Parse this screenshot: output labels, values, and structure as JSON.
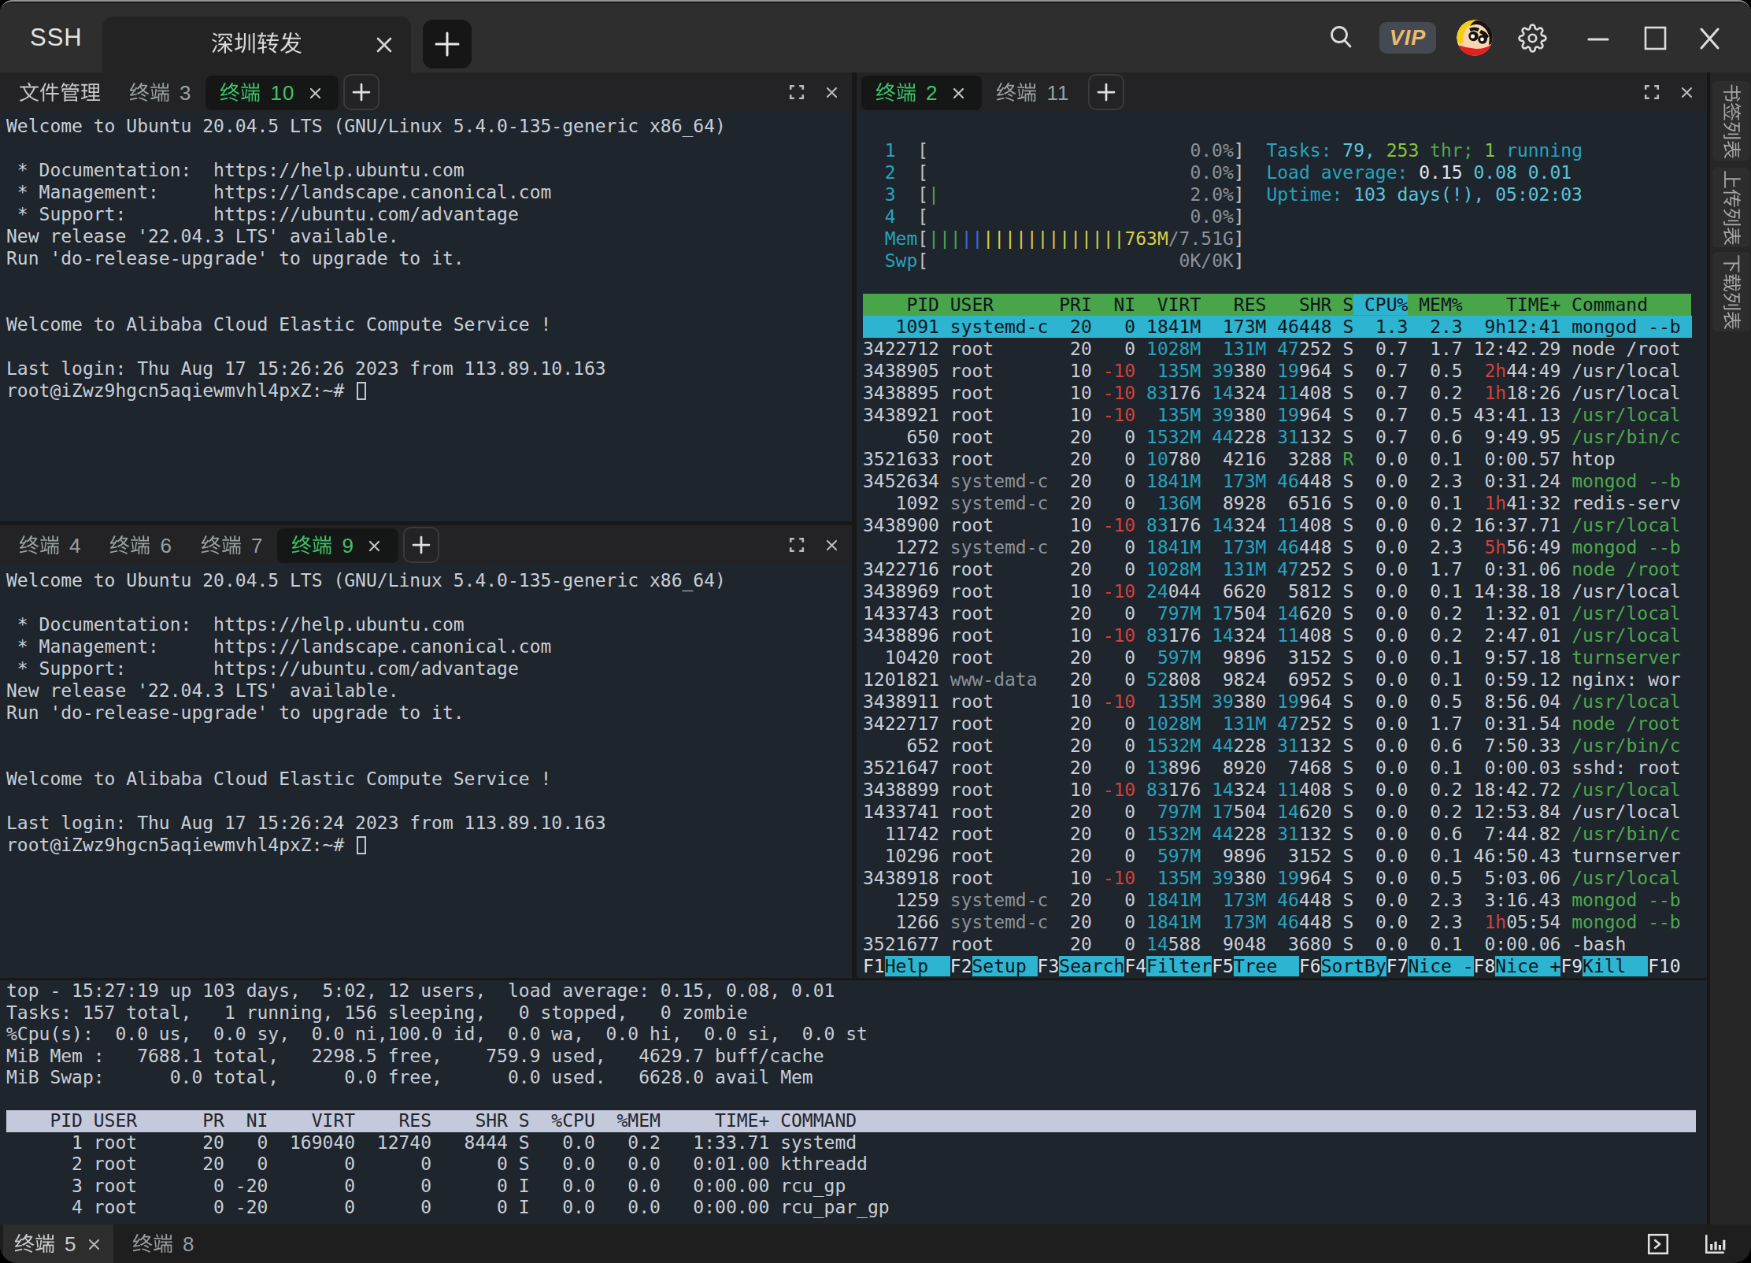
{
  "titlebar": {
    "app_label": "SSH",
    "window_tab": {
      "title": "深圳转发"
    },
    "new_tab_icon": "+",
    "vip_label": "VIP",
    "icons": [
      "search-icon",
      "vip-badge",
      "avatar",
      "gear-icon",
      "minimize-icon",
      "maximize-icon",
      "close-icon"
    ]
  },
  "panes": {
    "top_left": {
      "tabs": [
        {
          "label": "文件管理",
          "state": "first"
        },
        {
          "label": "终端",
          "num": "3",
          "state": "dim"
        },
        {
          "label": "终端",
          "num": "10",
          "state": "active",
          "closable": true
        }
      ],
      "terminal": {
        "lines": [
          "Welcome to Ubuntu 20.04.5 LTS (GNU/Linux 5.4.0-135-generic x86_64)",
          "",
          " * Documentation:  https://help.ubuntu.com",
          " * Management:     https://landscape.canonical.com",
          " * Support:        https://ubuntu.com/advantage",
          "New release '22.04.3 LTS' available.",
          "Run 'do-release-upgrade' to upgrade to it.",
          "",
          "",
          "Welcome to Alibaba Cloud Elastic Compute Service !",
          "",
          "Last login: Thu Aug 17 15:26:26 2023 from 113.89.10.163"
        ],
        "prompt": "root@iZwz9hgcn5aqiewmvhl4pxZ:~# "
      }
    },
    "bottom_left": {
      "tabs": [
        {
          "label": "终端",
          "num": "4",
          "state": "dim"
        },
        {
          "label": "终端",
          "num": "6",
          "state": "dim"
        },
        {
          "label": "终端",
          "num": "7",
          "state": "dim"
        },
        {
          "label": "终端",
          "num": "9",
          "state": "active",
          "closable": true
        }
      ],
      "terminal": {
        "lines": [
          "Welcome to Ubuntu 20.04.5 LTS (GNU/Linux 5.4.0-135-generic x86_64)",
          "",
          " * Documentation:  https://help.ubuntu.com",
          " * Management:     https://landscape.canonical.com",
          " * Support:        https://ubuntu.com/advantage",
          "New release '22.04.3 LTS' available.",
          "Run 'do-release-upgrade' to upgrade to it.",
          "",
          "",
          "Welcome to Alibaba Cloud Elastic Compute Service !",
          "",
          "Last login: Thu Aug 17 15:26:24 2023 from 113.89.10.163"
        ],
        "prompt": "root@iZwz9hgcn5aqiewmvhl4pxZ:~# "
      }
    },
    "right": {
      "tabs": [
        {
          "label": "终端",
          "num": "2",
          "state": "active",
          "closable": true
        },
        {
          "label": "终端",
          "num": "11",
          "state": "dim"
        }
      ],
      "htop": {
        "cpus": [
          {
            "id": "1",
            "bars": 0,
            "pct": "0.0%"
          },
          {
            "id": "2",
            "bars": 0,
            "pct": "0.0%"
          },
          {
            "id": "3",
            "bars": 1,
            "pct": "2.0%"
          },
          {
            "id": "4",
            "bars": 0,
            "pct": "0.0%"
          }
        ],
        "mem": {
          "label": "Mem",
          "green_bars": 3,
          "blue_bars": 2,
          "yellow_bars": 13,
          "used": "763M",
          "total": "/7.51G"
        },
        "swp": {
          "label": "Swp",
          "text": "0K/0K"
        },
        "summary": [
          [
            [
              "cyan",
              "Tasks: "
            ],
            [
              "bcyan",
              "79, "
            ],
            [
              "bgreen",
              "253 "
            ],
            [
              "green",
              "thr; "
            ],
            [
              "bgreen",
              "1 "
            ],
            [
              "cyan",
              "running"
            ]
          ],
          [
            [
              "cyan",
              "Load average: "
            ],
            [
              "white",
              "0.15 "
            ],
            [
              "bcyan",
              "0.08 0.01"
            ]
          ],
          [
            [
              "cyan",
              "Uptime: "
            ],
            [
              "bcyan",
              "103 days(!), 05:02:03"
            ]
          ]
        ],
        "header": "    PID USER      PRI  NI  VIRT   RES   SHR S CPU% MEM%    TIME+ Command",
        "sort_col": "CPU%",
        "rows": [
          {
            "pid": "1091",
            "user": "systemd-c",
            "pri": "20",
            "ni": "0",
            "virt": "1841M",
            "res": "173M",
            "shr": "46448",
            "s": "S",
            "cpu": "1.3",
            "mem": "2.3",
            "time": "9h12:41",
            "cmd": "mongod --b",
            "sel": true
          },
          {
            "pid": "3422712",
            "user": "root",
            "pri": "20",
            "ni": "0",
            "virt": "1028M",
            "res": "131M",
            "shr": "47252",
            "s": "S",
            "cpu": "0.7",
            "mem": "1.7",
            "time": "12:42.29",
            "cmd": "node /root"
          },
          {
            "pid": "3438905",
            "user": "root",
            "pri": "10",
            "ni": "-10",
            "virt": "135M",
            "res": "39380",
            "shr": "19964",
            "s": "S",
            "cpu": "0.7",
            "mem": "0.5",
            "time": "2h44:49",
            "cmd": "/usr/local"
          },
          {
            "pid": "3438895",
            "user": "root",
            "pri": "10",
            "ni": "-10",
            "virt": "83176",
            "res": "14324",
            "shr": "11408",
            "s": "S",
            "cpu": "0.7",
            "mem": "0.2",
            "time": "1h18:26",
            "cmd": "/usr/local"
          },
          {
            "pid": "3438921",
            "user": "root",
            "pri": "10",
            "ni": "-10",
            "virt": "135M",
            "res": "39380",
            "shr": "19964",
            "s": "S",
            "cpu": "0.7",
            "mem": "0.5",
            "time": "43:41.13",
            "cmd": "/usr/local",
            "cg": true
          },
          {
            "pid": "650",
            "user": "root",
            "pri": "20",
            "ni": "0",
            "virt": "1532M",
            "res": "44228",
            "shr": "31132",
            "s": "S",
            "cpu": "0.7",
            "mem": "0.6",
            "time": "9:49.95",
            "cmd": "/usr/bin/c",
            "cg": true
          },
          {
            "pid": "3521633",
            "user": "root",
            "pri": "20",
            "ni": "0",
            "virt": "10780",
            "res": "4216",
            "shr": "3288",
            "s": "R",
            "cpu": "0.0",
            "mem": "0.1",
            "time": "0:00.57",
            "cmd": "htop"
          },
          {
            "pid": "3452634",
            "user": "systemd-c",
            "pri": "20",
            "ni": "0",
            "virt": "1841M",
            "res": "173M",
            "shr": "46448",
            "s": "S",
            "cpu": "0.0",
            "mem": "2.3",
            "time": "0:31.24",
            "cmd": "mongod --b",
            "cg": true
          },
          {
            "pid": "1092",
            "user": "systemd-c",
            "pri": "20",
            "ni": "0",
            "virt": "136M",
            "res": "8928",
            "shr": "6516",
            "s": "S",
            "cpu": "0.0",
            "mem": "0.1",
            "time": "1h41:32",
            "cmd": "redis-serv"
          },
          {
            "pid": "3438900",
            "user": "root",
            "pri": "10",
            "ni": "-10",
            "virt": "83176",
            "res": "14324",
            "shr": "11408",
            "s": "S",
            "cpu": "0.0",
            "mem": "0.2",
            "time": "16:37.71",
            "cmd": "/usr/local",
            "cg": true
          },
          {
            "pid": "1272",
            "user": "systemd-c",
            "pri": "20",
            "ni": "0",
            "virt": "1841M",
            "res": "173M",
            "shr": "46448",
            "s": "S",
            "cpu": "0.0",
            "mem": "2.3",
            "time": "5h56:49",
            "cmd": "mongod --b",
            "cg": true
          },
          {
            "pid": "3422716",
            "user": "root",
            "pri": "20",
            "ni": "0",
            "virt": "1028M",
            "res": "131M",
            "shr": "47252",
            "s": "S",
            "cpu": "0.0",
            "mem": "1.7",
            "time": "0:31.06",
            "cmd": "node /root",
            "cg": true
          },
          {
            "pid": "3438969",
            "user": "root",
            "pri": "10",
            "ni": "-10",
            "virt": "24044",
            "res": "6620",
            "shr": "5812",
            "s": "S",
            "cpu": "0.0",
            "mem": "0.1",
            "time": "14:38.18",
            "cmd": "/usr/local"
          },
          {
            "pid": "1433743",
            "user": "root",
            "pri": "20",
            "ni": "0",
            "virt": "797M",
            "res": "17504",
            "shr": "14620",
            "s": "S",
            "cpu": "0.0",
            "mem": "0.2",
            "time": "1:32.01",
            "cmd": "/usr/local",
            "cg": true
          },
          {
            "pid": "3438896",
            "user": "root",
            "pri": "10",
            "ni": "-10",
            "virt": "83176",
            "res": "14324",
            "shr": "11408",
            "s": "S",
            "cpu": "0.0",
            "mem": "0.2",
            "time": "2:47.01",
            "cmd": "/usr/local",
            "cg": true
          },
          {
            "pid": "10420",
            "user": "root",
            "pri": "20",
            "ni": "0",
            "virt": "597M",
            "res": "9896",
            "shr": "3152",
            "s": "S",
            "cpu": "0.0",
            "mem": "0.1",
            "time": "9:57.18",
            "cmd": "turnserver",
            "cg": true
          },
          {
            "pid": "1201821",
            "user": "www-data",
            "pri": "20",
            "ni": "0",
            "virt": "52808",
            "res": "9824",
            "shr": "6952",
            "s": "S",
            "cpu": "0.0",
            "mem": "0.1",
            "time": "0:59.12",
            "cmd": "nginx: wor"
          },
          {
            "pid": "3438911",
            "user": "root",
            "pri": "10",
            "ni": "-10",
            "virt": "135M",
            "res": "39380",
            "shr": "19964",
            "s": "S",
            "cpu": "0.0",
            "mem": "0.5",
            "time": "8:56.04",
            "cmd": "/usr/local",
            "cg": true
          },
          {
            "pid": "3422717",
            "user": "root",
            "pri": "20",
            "ni": "0",
            "virt": "1028M",
            "res": "131M",
            "shr": "47252",
            "s": "S",
            "cpu": "0.0",
            "mem": "1.7",
            "time": "0:31.54",
            "cmd": "node /root",
            "cg": true
          },
          {
            "pid": "652",
            "user": "root",
            "pri": "20",
            "ni": "0",
            "virt": "1532M",
            "res": "44228",
            "shr": "31132",
            "s": "S",
            "cpu": "0.0",
            "mem": "0.6",
            "time": "7:50.33",
            "cmd": "/usr/bin/c",
            "cg": true
          },
          {
            "pid": "3521647",
            "user": "root",
            "pri": "20",
            "ni": "0",
            "virt": "13896",
            "res": "8920",
            "shr": "7468",
            "s": "S",
            "cpu": "0.0",
            "mem": "0.1",
            "time": "0:00.03",
            "cmd": "sshd: root"
          },
          {
            "pid": "3438899",
            "user": "root",
            "pri": "10",
            "ni": "-10",
            "virt": "83176",
            "res": "14324",
            "shr": "11408",
            "s": "S",
            "cpu": "0.0",
            "mem": "0.2",
            "time": "18:42.72",
            "cmd": "/usr/local",
            "cg": true
          },
          {
            "pid": "1433741",
            "user": "root",
            "pri": "20",
            "ni": "0",
            "virt": "797M",
            "res": "17504",
            "shr": "14620",
            "s": "S",
            "cpu": "0.0",
            "mem": "0.2",
            "time": "12:53.84",
            "cmd": "/usr/local"
          },
          {
            "pid": "11742",
            "user": "root",
            "pri": "20",
            "ni": "0",
            "virt": "1532M",
            "res": "44228",
            "shr": "31132",
            "s": "S",
            "cpu": "0.0",
            "mem": "0.6",
            "time": "7:44.82",
            "cmd": "/usr/bin/c",
            "cg": true
          },
          {
            "pid": "10296",
            "user": "root",
            "pri": "20",
            "ni": "0",
            "virt": "597M",
            "res": "9896",
            "shr": "3152",
            "s": "S",
            "cpu": "0.0",
            "mem": "0.1",
            "time": "46:50.43",
            "cmd": "turnserver"
          },
          {
            "pid": "3438918",
            "user": "root",
            "pri": "10",
            "ni": "-10",
            "virt": "135M",
            "res": "39380",
            "shr": "19964",
            "s": "S",
            "cpu": "0.0",
            "mem": "0.5",
            "time": "5:03.06",
            "cmd": "/usr/local",
            "cg": true
          },
          {
            "pid": "1259",
            "user": "systemd-c",
            "pri": "20",
            "ni": "0",
            "virt": "1841M",
            "res": "173M",
            "shr": "46448",
            "s": "S",
            "cpu": "0.0",
            "mem": "2.3",
            "time": "3:16.43",
            "cmd": "mongod --b",
            "cg": true
          },
          {
            "pid": "1266",
            "user": "systemd-c",
            "pri": "20",
            "ni": "0",
            "virt": "1841M",
            "res": "173M",
            "shr": "46448",
            "s": "S",
            "cpu": "0.0",
            "mem": "2.3",
            "time": "1h05:54",
            "cmd": "mongod --b",
            "cg": true
          },
          {
            "pid": "3521677",
            "user": "root",
            "pri": "20",
            "ni": "0",
            "virt": "14588",
            "res": "9048",
            "shr": "3680",
            "s": "S",
            "cpu": "0.0",
            "mem": "0.1",
            "time": "0:00.06",
            "cmd": "-bash"
          }
        ],
        "fkeys": [
          {
            "key": "F1",
            "label": "Help  "
          },
          {
            "key": "F2",
            "label": "Setup "
          },
          {
            "key": "F3",
            "label": "Search"
          },
          {
            "key": "F4",
            "label": "Filter"
          },
          {
            "key": "F5",
            "label": "Tree  "
          },
          {
            "key": "F6",
            "label": "SortBy"
          },
          {
            "key": "F7",
            "label": "Nice -"
          },
          {
            "key": "F8",
            "label": "Nice +"
          },
          {
            "key": "F9",
            "label": "Kill  "
          },
          {
            "key": "F10",
            "label": ""
          }
        ]
      }
    },
    "bottom": {
      "top_output": {
        "lines": [
          "top - 15:27:19 up 103 days,  5:02, 12 users,  load average: 0.15, 0.08, 0.01",
          "Tasks: 157 total,   1 running, 156 sleeping,   0 stopped,   0 zombie",
          "%Cpu(s):  0.0 us,  0.0 sy,  0.0 ni,100.0 id,  0.0 wa,  0.0 hi,  0.0 si,  0.0 st",
          "MiB Mem :   7688.1 total,   2298.5 free,    759.9 used,   4629.7 buff/cache",
          "MiB Swap:      0.0 total,      0.0 free,      0.0 used.   6628.0 avail Mem",
          ""
        ],
        "header": "    PID USER      PR  NI    VIRT    RES    SHR S  %CPU  %MEM     TIME+ COMMAND",
        "rows": [
          "      1 root      20   0  169040  12740   8444 S   0.0   0.2   1:33.71 systemd",
          "      2 root      20   0       0      0      0 S   0.0   0.0   0:01.00 kthreadd",
          "      3 root       0 -20       0      0      0 I   0.0   0.0   0:00.00 rcu_gp",
          "      4 root       0 -20       0      0      0 I   0.0   0.0   0:00.00 rcu_par_gp"
        ]
      }
    }
  },
  "bottom_bar": {
    "tabs": [
      {
        "label": "终端",
        "num": "5",
        "state": "active",
        "closable": true
      },
      {
        "label": "终端",
        "num": "8",
        "state": "dim"
      }
    ],
    "icons": [
      "terminal-icon",
      "chart-icon"
    ]
  },
  "sidebar": {
    "items": [
      {
        "label": "书签列表"
      },
      {
        "label": "上传列表"
      },
      {
        "label": "下载列表"
      }
    ]
  },
  "colors": {
    "terminal_bg": "#222b33",
    "accent_green": "#3fc367",
    "htop_header_bg": "#48a54a",
    "htop_selected_bg": "#2cb4d0",
    "top_header_bg": "#c5c9dc",
    "vip_gold": "#edbb6e"
  }
}
